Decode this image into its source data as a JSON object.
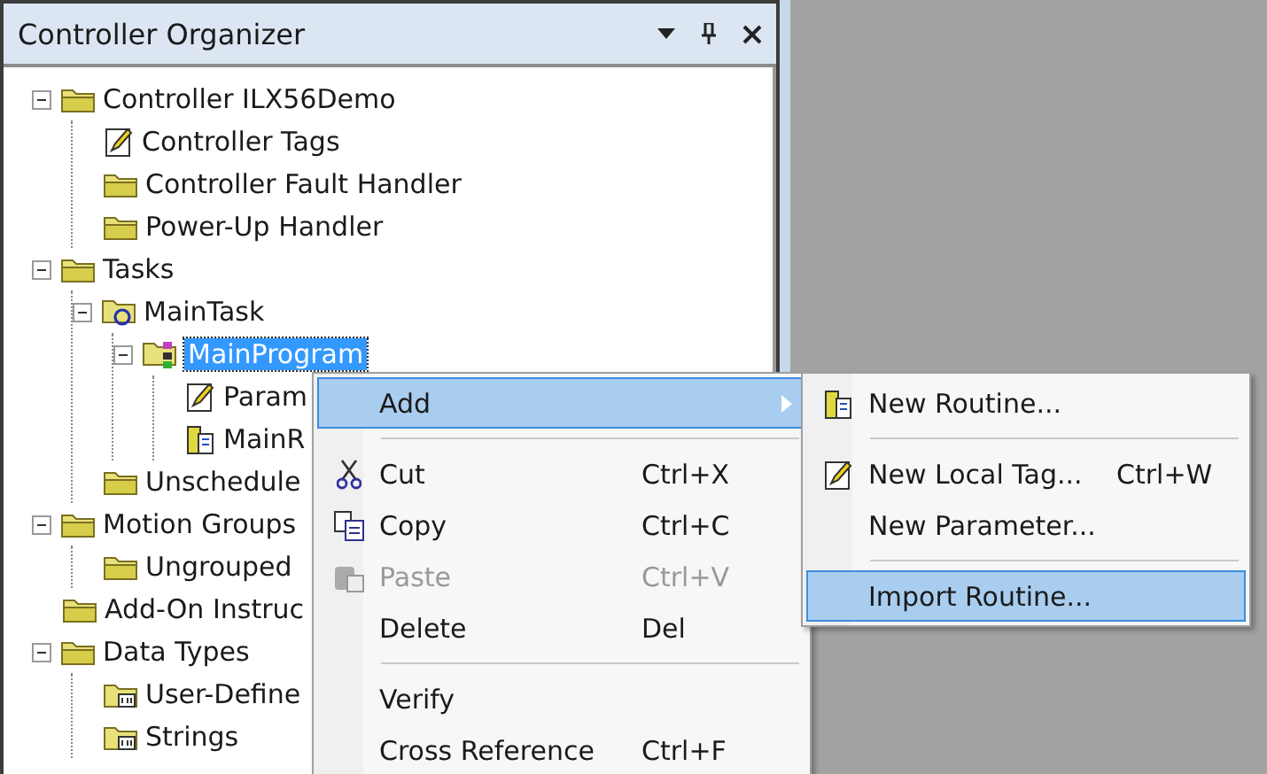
{
  "panel": {
    "title": "Controller Organizer"
  },
  "tree": [
    {
      "label": "Controller ILX56Demo",
      "kind": "folder",
      "expanded": true,
      "selected": false,
      "children": [
        {
          "label": "Controller Tags",
          "kind": "tags",
          "selected": false
        },
        {
          "label": "Controller Fault Handler",
          "kind": "folder",
          "selected": false
        },
        {
          "label": "Power-Up Handler",
          "kind": "folder",
          "selected": false
        }
      ]
    },
    {
      "label": "Tasks",
      "kind": "folder",
      "expanded": true,
      "selected": false,
      "children": [
        {
          "label": "MainTask",
          "kind": "task",
          "expanded": true,
          "selected": false,
          "children": [
            {
              "label": "MainProgram",
              "kind": "program",
              "expanded": true,
              "selected": true,
              "children": [
                {
                  "label": "Param",
                  "kind": "tags",
                  "selected": false
                },
                {
                  "label": "MainR",
                  "kind": "routine",
                  "selected": false
                }
              ]
            }
          ]
        },
        {
          "label": "Unschedule",
          "kind": "folder",
          "selected": false
        }
      ]
    },
    {
      "label": "Motion Groups",
      "kind": "folder",
      "expanded": true,
      "selected": false,
      "children": [
        {
          "label": "Ungrouped",
          "kind": "folder",
          "selected": false
        }
      ]
    },
    {
      "label": "Add-On Instruc",
      "kind": "folder",
      "selected": false
    },
    {
      "label": "Data Types",
      "kind": "folder",
      "expanded": true,
      "selected": false,
      "children": [
        {
          "label": "User-Define",
          "kind": "typefolder",
          "selected": false
        },
        {
          "label": "Strings",
          "kind": "typefolder",
          "selected": false
        }
      ]
    }
  ],
  "context_menu": [
    {
      "kind": "submenu",
      "label": "Add",
      "selected": true
    },
    {
      "kind": "separator"
    },
    {
      "kind": "cut",
      "label": "Cut",
      "shortcut": "Ctrl+X",
      "selected": false,
      "disabled": false
    },
    {
      "kind": "copy",
      "label": "Copy",
      "shortcut": "Ctrl+C",
      "selected": false,
      "disabled": false
    },
    {
      "kind": "paste",
      "label": "Paste",
      "shortcut": "Ctrl+V",
      "selected": false,
      "disabled": true
    },
    {
      "kind": "item",
      "label": "Delete",
      "shortcut": "Del",
      "selected": false,
      "disabled": false
    },
    {
      "kind": "separator"
    },
    {
      "kind": "item",
      "label": "Verify",
      "selected": false,
      "disabled": false
    },
    {
      "kind": "item",
      "label": "Cross Reference",
      "shortcut": "Ctrl+F",
      "selected": false,
      "disabled": false
    }
  ],
  "submenu": [
    {
      "kind": "routine",
      "label": "New Routine...",
      "selected": false
    },
    {
      "kind": "separator"
    },
    {
      "kind": "tags",
      "label": "New Local Tag...",
      "shortcut": "Ctrl+W",
      "selected": false
    },
    {
      "kind": "item",
      "label": "New Parameter...",
      "selected": false
    },
    {
      "kind": "separator"
    },
    {
      "kind": "item",
      "label": "Import Routine...",
      "selected": true
    }
  ]
}
